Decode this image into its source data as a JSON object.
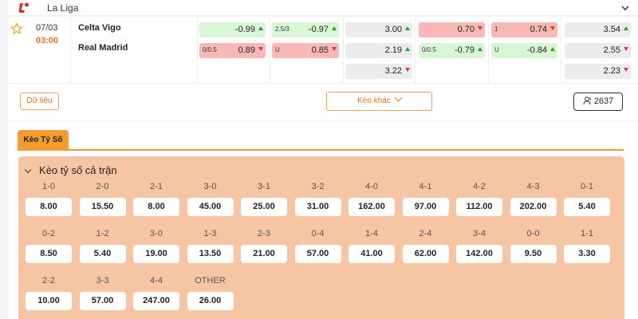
{
  "league": {
    "name": "La Liga",
    "logo_icon": "la-liga-logo",
    "collapse_icon": "chevron-up-icon"
  },
  "match": {
    "date": "07/03",
    "time": "03:00",
    "home": "Celta Vigo",
    "away": "Real Madrid",
    "odds": {
      "hdp_home": {
        "label": "",
        "value": "-0.99",
        "trend": "up",
        "color": "green"
      },
      "hdp_away": {
        "label": "0/0.5",
        "value": "0.89",
        "trend": "down",
        "color": "red"
      },
      "ou_over": {
        "label": "2.5/3",
        "value": "-0.97",
        "trend": "up",
        "color": "green"
      },
      "ou_under": {
        "label": "U",
        "value": "0.85",
        "trend": "down",
        "color": "red"
      },
      "x12_home": {
        "value": "3.00",
        "trend": "up"
      },
      "x12_away": {
        "value": "2.19",
        "trend": "up"
      },
      "x12_draw": {
        "value": "3.22",
        "trend": "down"
      },
      "h1_hdp_home": {
        "label": "",
        "value": "0.70",
        "trend": "down",
        "color": "red"
      },
      "h1_hdp_away": {
        "label": "0/0.5",
        "value": "-0.79",
        "trend": "up",
        "color": "green"
      },
      "h1_ou_over": {
        "label": "1",
        "value": "0.74",
        "trend": "down",
        "color": "red"
      },
      "h1_ou_under": {
        "label": "U",
        "value": "-0.84",
        "trend": "up",
        "color": "green"
      },
      "h1_x12_home": {
        "value": "3.54",
        "trend": "up"
      },
      "h1_x12_away": {
        "value": "2.55",
        "trend": "down"
      },
      "h1_x12_draw": {
        "value": "2.23",
        "trend": "down"
      }
    },
    "data_button": "Dữ liệu",
    "more_button": "Kèo khác",
    "viewers": "2637"
  },
  "correct_score": {
    "tab": "Kèo Tỷ Số",
    "title": "Kèo tỷ số cả trận",
    "rows": [
      [
        {
          "s": "1-0",
          "o": "8.00"
        },
        {
          "s": "2-0",
          "o": "15.50"
        },
        {
          "s": "2-1",
          "o": "8.00"
        },
        {
          "s": "3-0",
          "o": "45.00"
        },
        {
          "s": "3-1",
          "o": "25.00"
        },
        {
          "s": "3-2",
          "o": "31.00"
        },
        {
          "s": "4-0",
          "o": "162.00"
        },
        {
          "s": "4-1",
          "o": "97.00"
        },
        {
          "s": "4-2",
          "o": "112.00"
        },
        {
          "s": "4-3",
          "o": "202.00"
        },
        {
          "s": "0-1",
          "o": "5.40"
        }
      ],
      [
        {
          "s": "0-2",
          "o": "8.50"
        },
        {
          "s": "1-2",
          "o": "5.40"
        },
        {
          "s": "3-0",
          "o": "19.00"
        },
        {
          "s": "1-3",
          "o": "13.50"
        },
        {
          "s": "2-3",
          "o": "21.00"
        },
        {
          "s": "0-4",
          "o": "57.00"
        },
        {
          "s": "1-4",
          "o": "41.00"
        },
        {
          "s": "2-4",
          "o": "62.00"
        },
        {
          "s": "3-4",
          "o": "142.00"
        },
        {
          "s": "0-0",
          "o": "9.50"
        },
        {
          "s": "1-1",
          "o": "3.30"
        }
      ],
      [
        {
          "s": "2-2",
          "o": "10.00"
        },
        {
          "s": "3-3",
          "o": "57.00"
        },
        {
          "s": "4-4",
          "o": "247.00"
        },
        {
          "s": "OTHER",
          "o": "26.00"
        }
      ]
    ]
  },
  "colors": {
    "accent": "#f39c2f",
    "time": "#e8701a",
    "up": "#26a334",
    "down": "#d83a3a",
    "panel": "#f6c6a4"
  }
}
